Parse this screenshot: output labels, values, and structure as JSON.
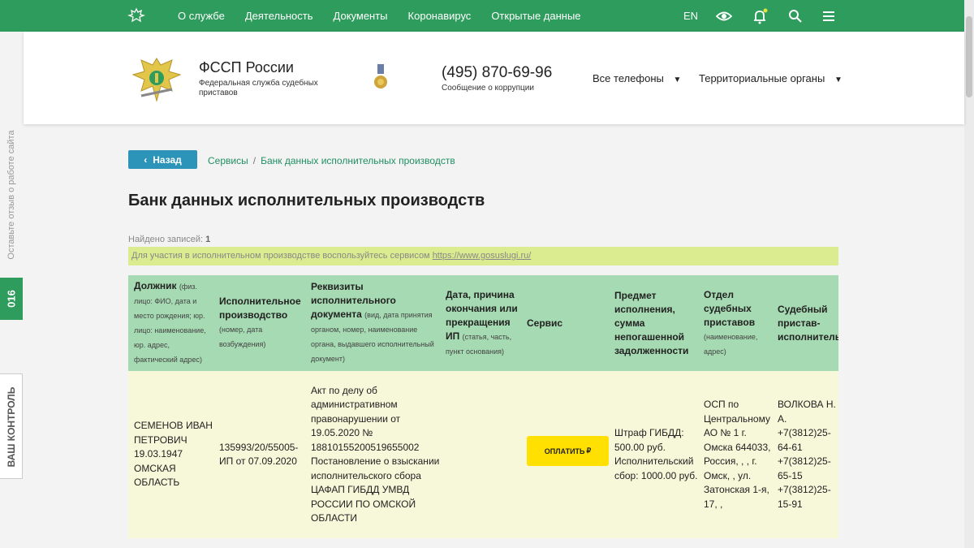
{
  "topbar": {
    "nav": [
      "О службе",
      "Деятельность",
      "Документы",
      "Коронавирус",
      "Открытые данные"
    ],
    "lang": "EN"
  },
  "header": {
    "org_name": "ФССП России",
    "org_sub": "Федеральная служба судебных приставов",
    "phone": "(495) 870-69-96",
    "corruption": "Сообщение о коррупции",
    "dropdown1": "Все телефоны",
    "dropdown2": "Территориальные органы"
  },
  "side": {
    "feedback": "Оставьте отзыв о работе сайта",
    "hotline": "016",
    "control": "ВАШ КОНТРОЛЬ"
  },
  "page": {
    "back": "Назад",
    "breadcrumb": [
      "Сервисы",
      "Банк данных исполнительных производств"
    ],
    "title": "Банк данных исполнительных производств",
    "found_label": "Найдено записей:",
    "found_count": "1",
    "notice_text": "Для участия в исполнительном производстве воспользуйтесь сервисом",
    "notice_link": "https://www.gosuslugi.ru/"
  },
  "table": {
    "headers": [
      {
        "title": "Должник",
        "note": "(физ. лицо: ФИО, дата и место рождения; юр. лицо: наименование, юр. адрес, фактический адрес)"
      },
      {
        "title": "Исполнительное производство",
        "note": "(номер, дата возбуждения)"
      },
      {
        "title": "Реквизиты исполнительного документа",
        "note": "(вид, дата принятия органом, номер, наименование органа, выдавшего исполнительный документ)"
      },
      {
        "title": "Дата, причина окончания или прекращения ИП",
        "note": "(статья, часть, пункт основания)"
      },
      {
        "title": "Сервис",
        "note": ""
      },
      {
        "title": "Предмет исполнения, сумма непогашенной задолженности",
        "note": ""
      },
      {
        "title": "Отдел судебных приставов",
        "note": "(наименование, адрес)"
      },
      {
        "title": "Судебный пристав-исполнитель",
        "note": ""
      }
    ],
    "row": {
      "debtor": "СЕМЕНОВ ИВАН ПЕТРОВИЧ 19.03.1947 ОМСКАЯ ОБЛАСТЬ",
      "proceeding": "135993/20/55005-ИП от 07.09.2020",
      "document": "Акт по делу об административном правонарушении от 19.05.2020 № 18810155200519655002 Постановление о взыскании исполнительского сбора ЦАФАП ГИБДД УМВД РОССИИ ПО ОМСКОЙ ОБЛАСТИ",
      "end_date": "",
      "service_button": "ОПЛАТИТЬ",
      "subject": "Штраф ГИБДД: 500.00 руб. Исполнительский сбор: 1000.00 руб.",
      "department": "ОСП по Центральному АО № 1 г. Омска 644033, Россия, , , г. Омск, , ул. Затонская 1-я, 17, ,",
      "bailiff": "ВОЛКОВА Н. А. +7(3812)25-64-61 +7(3812)25-65-15 +7(3812)25-15-91"
    }
  }
}
